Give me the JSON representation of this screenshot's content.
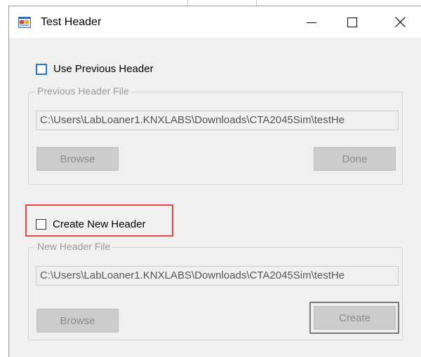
{
  "window": {
    "title": "Test Header",
    "controls": {
      "minimize_icon": "minimize-icon",
      "maximize_icon": "maximize-icon",
      "close_icon": "close-icon"
    }
  },
  "use_previous": {
    "checkbox_label": "Use Previous Header",
    "checked": false,
    "group_title": "Previous Header File",
    "path": "C:\\Users\\LabLoaner1.KNXLABS\\Downloads\\CTA2045Sim\\testHe",
    "browse_label": "Browse",
    "done_label": "Done"
  },
  "create_new": {
    "checkbox_label": "Create New Header",
    "checked": false,
    "group_title": "New Header File",
    "path": "C:\\Users\\LabLoaner1.KNXLABS\\Downloads\\CTA2045Sim\\testHe",
    "browse_label": "Browse",
    "create_label": "Create"
  },
  "colors": {
    "highlight": "#e04747",
    "focus_checkbox": "#1b78d0",
    "disabled_button": "#cccccc"
  }
}
